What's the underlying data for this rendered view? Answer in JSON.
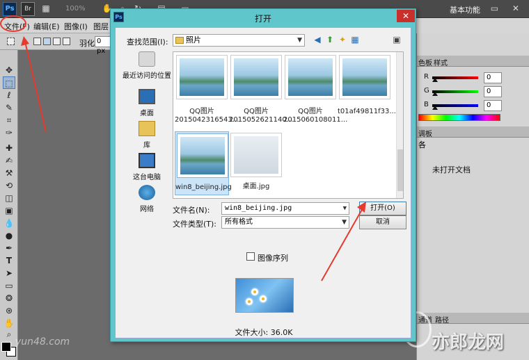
{
  "app": {
    "ps_logo": "Ps",
    "bridge_logo": "Br",
    "zoom": "100%",
    "workspace": "基本功能",
    "window_controls": "– ▭ ✕"
  },
  "menu": [
    "文件(F)",
    "编辑(E)",
    "图像(I)",
    "图层("
  ],
  "options": {
    "feather_label": "羽化:",
    "feather_value": "0 px"
  },
  "right_panel": {
    "top_tabs": [
      "色板",
      "样式"
    ],
    "sliders": [
      {
        "letter": "R",
        "value": "0",
        "color": "#d63a3a"
      },
      {
        "letter": "G",
        "value": "0",
        "color": "#3ab23a"
      },
      {
        "letter": "B",
        "value": "0",
        "color": "#3a5ad6"
      }
    ],
    "mid_tab": "调板",
    "mid_label": "各",
    "no_document": "未打开文档",
    "bottom_tabs": [
      "通道",
      "路径"
    ]
  },
  "dialog": {
    "title": "打开",
    "close": "✕",
    "lookin_label": "查找范围(I):",
    "lookin_value": "照片",
    "places": [
      {
        "label": "最近访问的位置",
        "icon": "recent-places-icon"
      },
      {
        "label": "桌面",
        "icon": "desktop-icon"
      },
      {
        "label": "库",
        "icon": "library-icon"
      },
      {
        "label": "这台电脑",
        "icon": "computer-icon"
      },
      {
        "label": "网络",
        "icon": "network-icon"
      }
    ],
    "files": [
      {
        "name": "QQ图片2015042316543..."
      },
      {
        "name": "QQ图片2015052621140..."
      },
      {
        "name": "QQ图片2015060108011..."
      },
      {
        "name": "t01af49811f33..."
      },
      {
        "name": "win8_beijing.jpg"
      },
      {
        "name": "桌面.jpg"
      }
    ],
    "filename_label": "文件名(N):",
    "filename_value": "win8_beijing.jpg",
    "filetype_label": "文件类型(T):",
    "filetype_value": "所有格式",
    "open_button": "打开(O)",
    "cancel_button": "取消",
    "image_sequence": "图像序列",
    "file_size": "文件大小: 36.0K"
  },
  "watermarks": {
    "left": "yun48.com",
    "right": "亦郎龙网"
  },
  "colors": {
    "annotation": "#e53a2e",
    "dialog_frame": "#5fc6cc",
    "selection": "#cce4f7"
  }
}
